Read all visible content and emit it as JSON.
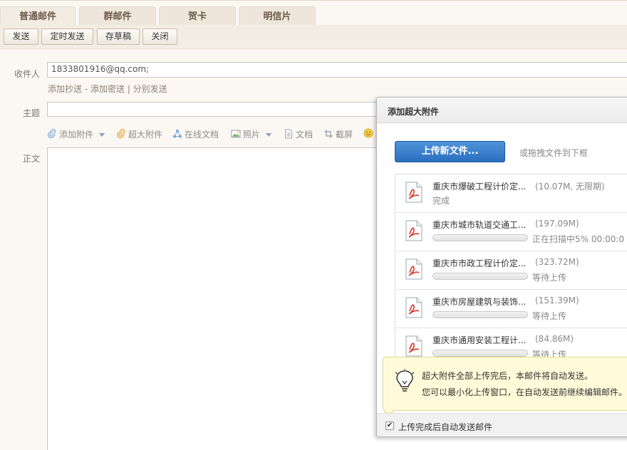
{
  "tabs": [
    {
      "label": "普通邮件"
    },
    {
      "label": "群邮件"
    },
    {
      "label": "贺卡"
    },
    {
      "label": "明信片"
    }
  ],
  "toolbar": {
    "send": "发送",
    "scheduled_send": "定时发送",
    "save_draft": "存草稿",
    "close": "关闭"
  },
  "form": {
    "recipient_label": "收件人",
    "recipient_value": "1833801916@qq.com;",
    "add_cc": "添加抄送",
    "add_bcc": "添加密送",
    "separate_send": "分别发送",
    "link_sep1": " - ",
    "link_sep2": " | ",
    "subject_label": "主题",
    "subject_value": "",
    "body_label": "正文"
  },
  "editor_toolbar": {
    "add_attachment": "添加附件",
    "large_attachment": "超大附件",
    "online_doc": "在线文档",
    "photo": "照片",
    "document": "文档",
    "screenshot": "截屏"
  },
  "dialog": {
    "title": "添加超大附件",
    "upload_button": "上传新文件...",
    "drag_hint": "或拖拽文件到下框",
    "files": [
      {
        "name": "重庆市爆破工程计价定...",
        "size": "(10.07M, 无限期)",
        "status": "完成",
        "progress": 1.0
      },
      {
        "name": "重庆市城市轨道交通工...",
        "size": "(197.09M)",
        "status": "正在扫描中5%  00:00:0",
        "progress": 0.0
      },
      {
        "name": "重庆市市政工程计价定...",
        "size": "(323.72M)",
        "status": "等待上传",
        "progress": 0.0
      },
      {
        "name": "重庆市房屋建筑与装饰...",
        "size": "(151.39M)",
        "status": "等待上传",
        "progress": 0.0
      },
      {
        "name": "重庆市通用安装工程计...",
        "size": "(84.86M)",
        "status": "等待上传",
        "progress": 0.0
      }
    ],
    "tip_line1": "超大附件全部上传完后，本邮件将自动发送。",
    "tip_line2": "您可以最小化上传窗口，在自动发送前继续编辑邮件。",
    "auto_send_label": "上传完成后自动发送邮件",
    "auto_send_checked": true
  },
  "colors": {
    "upload_button": "#2a6fc0",
    "progress_fill": "#58a5e3",
    "tip_background": "#fffbd9"
  }
}
